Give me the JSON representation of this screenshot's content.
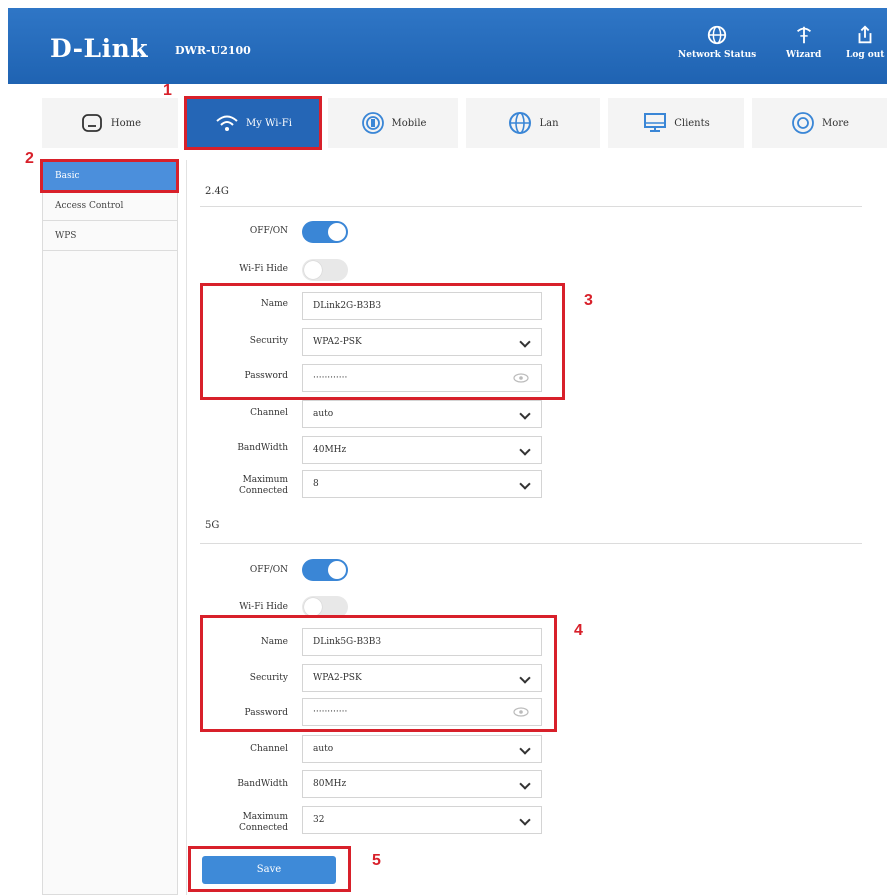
{
  "header": {
    "logo": "D-Link",
    "model": "DWR-U2100",
    "buttons": [
      {
        "label": "Network Status",
        "icon": "globe-icon"
      },
      {
        "label": "Wizard",
        "icon": "wand-icon"
      },
      {
        "label": "Log out",
        "icon": "logout-icon"
      }
    ]
  },
  "nav": [
    {
      "label": "Home",
      "icon": "home-icon"
    },
    {
      "label": "My Wi-Fi",
      "icon": "wifi-icon",
      "active": true
    },
    {
      "label": "Mobile",
      "icon": "mobile-icon"
    },
    {
      "label": "Lan",
      "icon": "lan-globe-icon"
    },
    {
      "label": "Clients",
      "icon": "monitor-icon"
    },
    {
      "label": "More",
      "icon": "more-icon"
    }
  ],
  "sidebar": {
    "items": [
      {
        "label": "Basic",
        "active": true
      },
      {
        "label": "Access Control"
      },
      {
        "label": "WPS"
      }
    ]
  },
  "band24": {
    "title": "2.4G",
    "switch_label": "OFF/ON",
    "switch_on": true,
    "hide_label": "Wi-Fi Hide",
    "hide_on": false,
    "name_label": "Name",
    "name_value": "DLink2G-B3B3",
    "security_label": "Security",
    "security_value": "WPA2-PSK",
    "password_label": "Password",
    "password_value": "············",
    "channel_label": "Channel",
    "channel_value": "auto",
    "bandwidth_label": "BandWidth",
    "bandwidth_value": "40MHz",
    "max_label_1": "Maximum",
    "max_label_2": "Connected",
    "max_value": "8"
  },
  "band5": {
    "title": "5G",
    "switch_label": "OFF/ON",
    "switch_on": true,
    "hide_label": "Wi-Fi Hide",
    "hide_on": false,
    "name_label": "Name",
    "name_value": "DLink5G-B3B3",
    "security_label": "Security",
    "security_value": "WPA2-PSK",
    "password_label": "Password",
    "password_value": "············",
    "channel_label": "Channel",
    "channel_value": "auto",
    "bandwidth_label": "BandWidth",
    "bandwidth_value": "80MHz",
    "max_label_1": "Maximum",
    "max_label_2": "Connected",
    "max_value": "32"
  },
  "save_label": "Save",
  "annotations": [
    "1",
    "2",
    "3",
    "4",
    "5"
  ],
  "colors": {
    "header": "#2266b6",
    "active_nav": "#2566b6",
    "accent": "#3a86d6",
    "annotation_red": "#d8202a"
  }
}
